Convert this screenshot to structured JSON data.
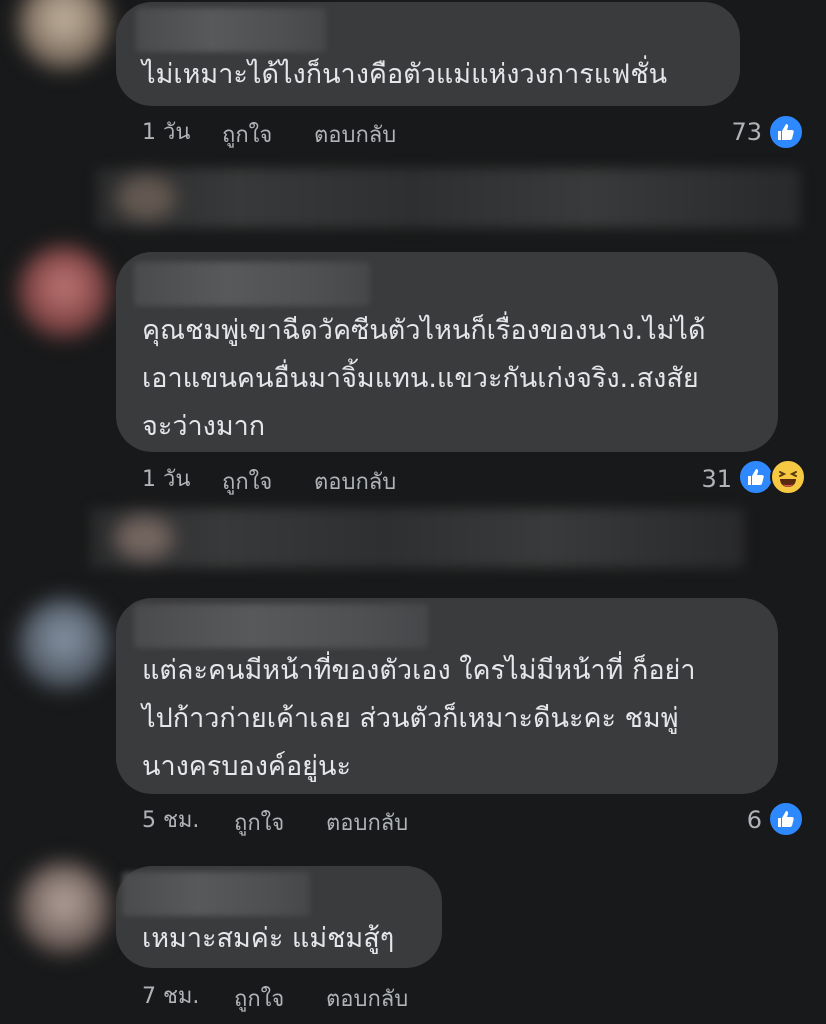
{
  "comments": [
    {
      "text": "ไม่เหมาะได้ไงก็นางคือตัวแม่แห่งวงการแฟชั่น",
      "time": "1 วัน",
      "like_label": "ถูกใจ",
      "reply_label": "ตอบกลับ",
      "reaction_count": "73",
      "reactions": [
        "like-icon"
      ]
    },
    {
      "lines": [
        "คุณชมพู่เขาฉีดวัคซีนตัวไหนก็เรื่องของนาง.ไม่ได้",
        "เอาแขนคนอื่นมาจิ้มแทน.แขวะกันเก่งจริง..สงสัย",
        "จะว่างมาก"
      ],
      "time": "1 วัน",
      "like_label": "ถูกใจ",
      "reply_label": "ตอบกลับ",
      "reaction_count": "31",
      "reactions": [
        "like-icon",
        "haha-icon"
      ]
    },
    {
      "lines": [
        "แต่ละคนมีหน้าที่ของตัวเอง ใครไม่มีหน้าที่ ก็อย่า",
        "ไปก้าวก่ายเค้าเลย ส่วนตัวก็เหมาะดีนะคะ ชมพู่",
        "นางครบองค์อยู่นะ"
      ],
      "time": "5 ชม.",
      "like_label": "ถูกใจ",
      "reply_label": "ตอบกลับ",
      "reaction_count": "6",
      "reactions": [
        "like-icon"
      ]
    },
    {
      "text": "เหมาะสมค่ะ แม่ชมสู้ๆ",
      "time": "7 ชม.",
      "like_label": "ถูกใจ",
      "reply_label": "ตอบกลับ"
    }
  ],
  "colors": {
    "background": "#18191a",
    "bubble": "#3a3b3c",
    "text": "#e4e6eb",
    "meta": "#b0b3b8",
    "like": "#2e89ff",
    "haha": "#f7c943"
  }
}
